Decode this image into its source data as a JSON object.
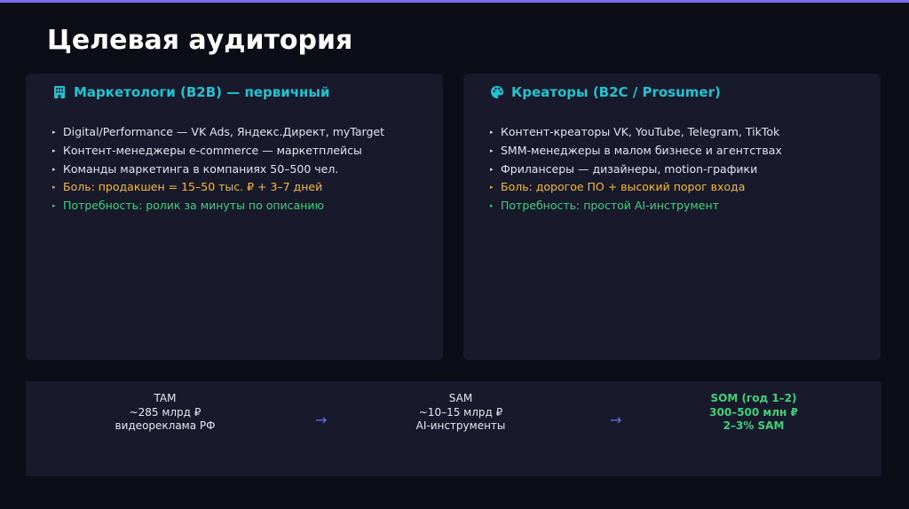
{
  "slide": {
    "title": "Целевая аудитория"
  },
  "cards": {
    "left": {
      "icon": "office-building-icon",
      "heading": "Маркетологи (B2B) — первичный",
      "items": [
        "Digital/Performance — VK Ads, Яндекс.Директ, myTarget",
        "Контент-менеджеры e-commerce — маркетплейсы",
        "Команды маркетинга в компаниях 50–500 чел.",
        "Боль: продакшен = 15–50 тыс. ₽ + 3–7 дней",
        "Потребность: ролик за минуты по описанию"
      ]
    },
    "right": {
      "icon": "palette-icon",
      "heading": "Креаторы (B2C / Prosumer)",
      "items": [
        "Контент-креаторы VK, YouTube, Telegram, TikTok",
        "SMM-менеджеры в малом бизнесе и агентствах",
        "Фрилансеры — дизайнеры, motion-графики",
        "Боль: дорогое ПО + высокий порог входа",
        "Потребность: простой AI-инструмент"
      ]
    }
  },
  "market": {
    "tam": {
      "label": "TAM",
      "value": "~285 млрд ₽",
      "desc": "видеореклама РФ"
    },
    "sam": {
      "label": "SAM",
      "value": "~10–15 млрд ₽",
      "desc": "AI-инструменты"
    },
    "som": {
      "label": "SOM (год 1–2)",
      "value": "300–500 млн ₽",
      "desc": "2–3% SAM"
    },
    "arrow": "→"
  },
  "colors": {
    "accent_bar": "#7b6cf0",
    "heading": "#22c3d0",
    "pain": "#f4b93a",
    "need": "#3fd07a",
    "arrow": "#6b6fe8",
    "card_bg": "#181a2c",
    "page_bg": "#0d0d17"
  }
}
